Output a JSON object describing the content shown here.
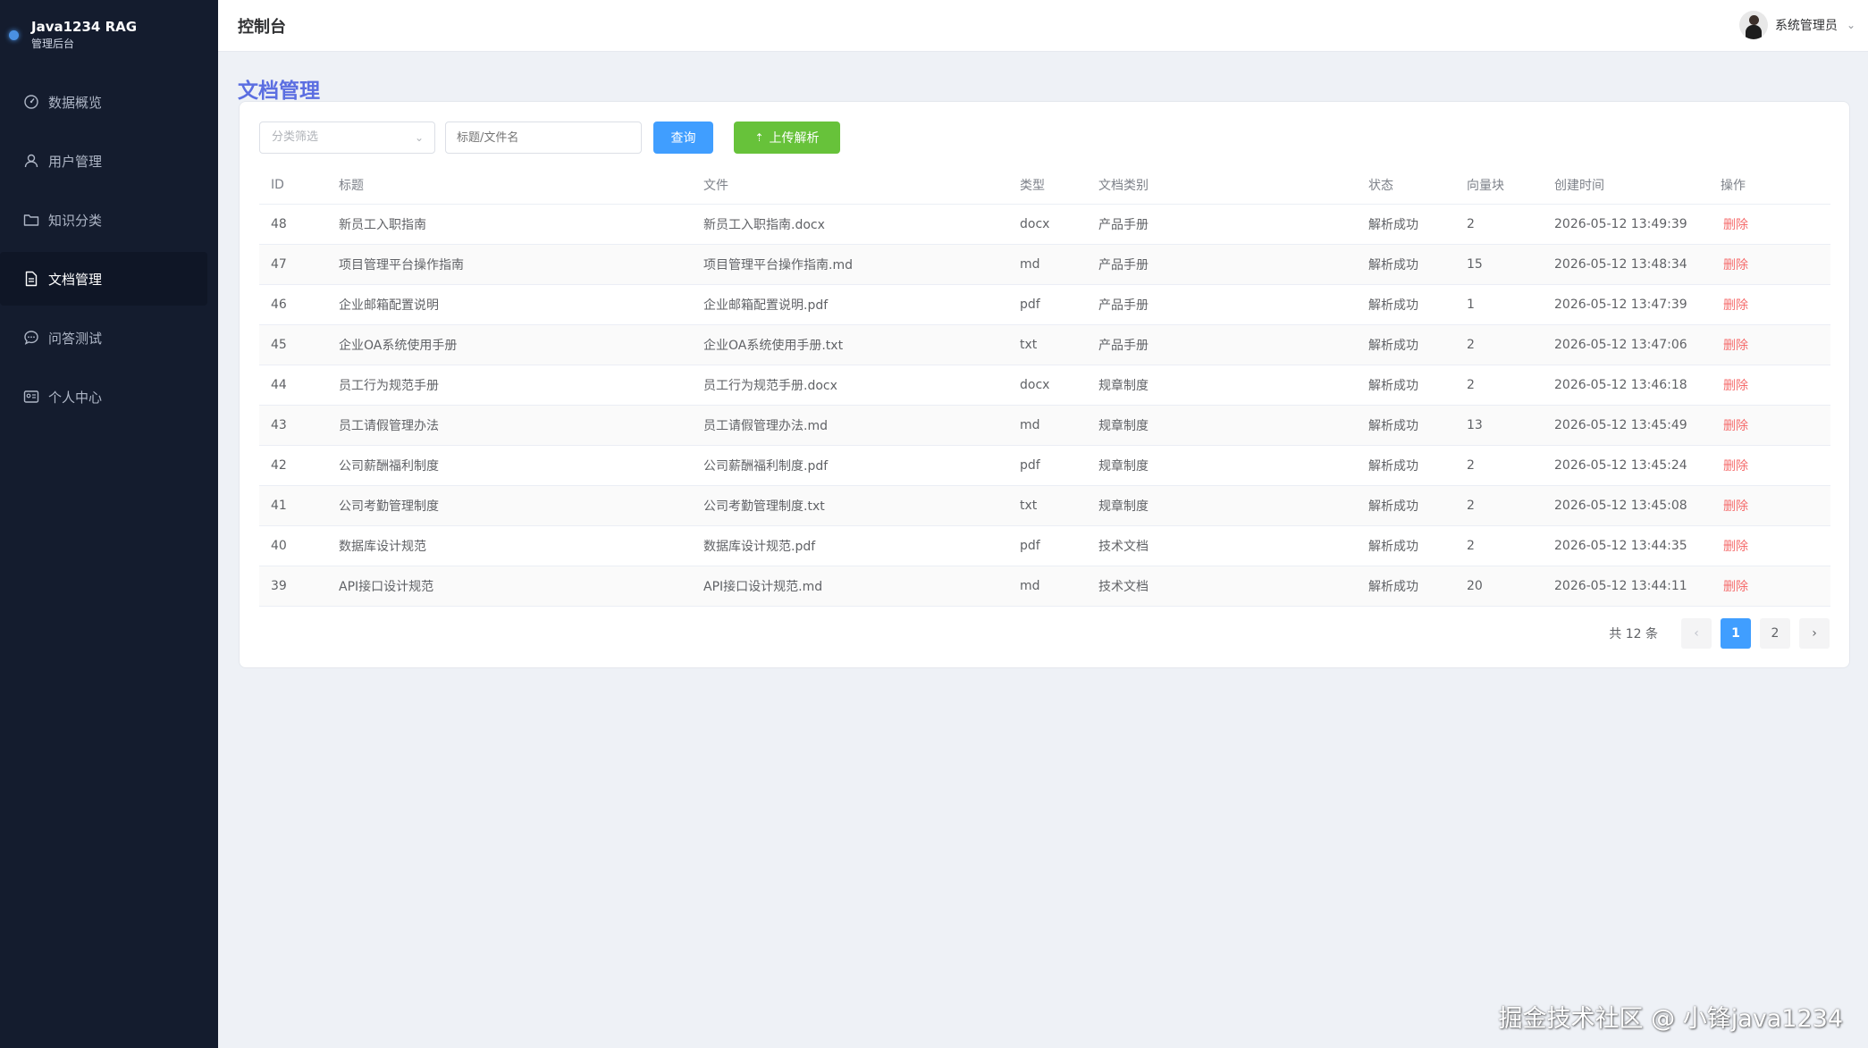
{
  "brand": {
    "title": "Java1234 RAG",
    "subtitle": "管理后台"
  },
  "sidebar": {
    "items": [
      {
        "label": "数据概览",
        "icon": "dashboard-icon"
      },
      {
        "label": "用户管理",
        "icon": "user-icon"
      },
      {
        "label": "知识分类",
        "icon": "folder-icon"
      },
      {
        "label": "文档管理",
        "icon": "document-icon",
        "active": true
      },
      {
        "label": "问答测试",
        "icon": "chat-icon"
      },
      {
        "label": "个人中心",
        "icon": "profile-card-icon"
      }
    ]
  },
  "header": {
    "title": "控制台",
    "user_name": "系统管理员"
  },
  "main": {
    "page_title": "文档管理",
    "filters": {
      "category_placeholder": "分类筛选",
      "keyword_placeholder": "标题/文件名",
      "query_label": "查询",
      "upload_label": "上传解析"
    },
    "table": {
      "headers": [
        "ID",
        "标题",
        "文件",
        "类型",
        "文档类别",
        "状态",
        "向量块",
        "创建时间",
        "操作"
      ],
      "rows": [
        [
          "48",
          "新员工入职指南",
          "新员工入职指南.docx",
          "docx",
          "产品手册",
          "解析成功",
          "2",
          "2026-05-12 13:49:39",
          "删除"
        ],
        [
          "47",
          "项目管理平台操作指南",
          "项目管理平台操作指南.md",
          "md",
          "产品手册",
          "解析成功",
          "15",
          "2026-05-12 13:48:34",
          "删除"
        ],
        [
          "46",
          "企业邮箱配置说明",
          "企业邮箱配置说明.pdf",
          "pdf",
          "产品手册",
          "解析成功",
          "1",
          "2026-05-12 13:47:39",
          "删除"
        ],
        [
          "45",
          "企业OA系统使用手册",
          "企业OA系统使用手册.txt",
          "txt",
          "产品手册",
          "解析成功",
          "2",
          "2026-05-12 13:47:06",
          "删除"
        ],
        [
          "44",
          "员工行为规范手册",
          "员工行为规范手册.docx",
          "docx",
          "规章制度",
          "解析成功",
          "2",
          "2026-05-12 13:46:18",
          "删除"
        ],
        [
          "43",
          "员工请假管理办法",
          "员工请假管理办法.md",
          "md",
          "规章制度",
          "解析成功",
          "13",
          "2026-05-12 13:45:49",
          "删除"
        ],
        [
          "42",
          "公司薪酬福利制度",
          "公司薪酬福利制度.pdf",
          "pdf",
          "规章制度",
          "解析成功",
          "2",
          "2026-05-12 13:45:24",
          "删除"
        ],
        [
          "41",
          "公司考勤管理制度",
          "公司考勤管理制度.txt",
          "txt",
          "规章制度",
          "解析成功",
          "2",
          "2026-05-12 13:45:08",
          "删除"
        ],
        [
          "40",
          "数据库设计规范",
          "数据库设计规范.pdf",
          "pdf",
          "技术文档",
          "解析成功",
          "2",
          "2026-05-12 13:44:35",
          "删除"
        ],
        [
          "39",
          "API接口设计规范",
          "API接口设计规范.md",
          "md",
          "技术文档",
          "解析成功",
          "20",
          "2026-05-12 13:44:11",
          "删除"
        ]
      ]
    },
    "pagination": {
      "total_label": "共 12 条",
      "prev": "‹",
      "next": "›",
      "pages": [
        "1",
        "2"
      ],
      "current": "1"
    }
  },
  "watermark": "掘金技术社区 @ 小锋java1234",
  "colors": {
    "sidebar_bg": "#141c2e",
    "primary": "#409eff",
    "success": "#67c23a",
    "danger": "#f56c6c",
    "title": "#5b6ee1"
  }
}
